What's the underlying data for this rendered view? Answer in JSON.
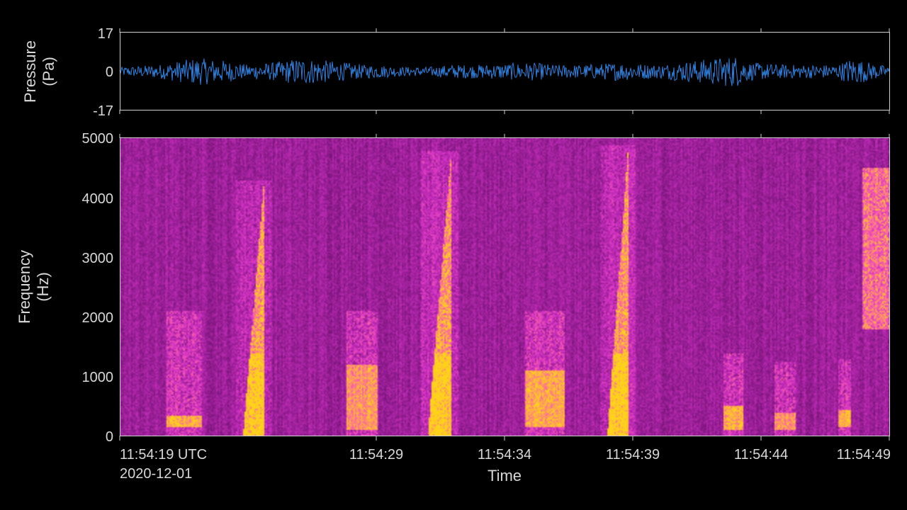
{
  "chart_data": [
    {
      "type": "line",
      "ylabel_line1": "Pressure",
      "ylabel_line2": "(Pa)",
      "ylim": [
        -17,
        17
      ],
      "yticks": [
        "17",
        "0",
        "-17"
      ],
      "color": "#2f7fdc",
      "time_range_s": [
        0,
        30
      ],
      "amplitude_envelope": [
        {
          "t": 0,
          "a": 2
        },
        {
          "t": 1.5,
          "a": 3
        },
        {
          "t": 3,
          "a": 6
        },
        {
          "t": 4,
          "a": 5
        },
        {
          "t": 5,
          "a": 3
        },
        {
          "t": 6,
          "a": 4
        },
        {
          "t": 7,
          "a": 6
        },
        {
          "t": 8,
          "a": 5
        },
        {
          "t": 9.5,
          "a": 3
        },
        {
          "t": 10,
          "a": 3
        },
        {
          "t": 11,
          "a": 2
        },
        {
          "t": 12,
          "a": 2
        },
        {
          "t": 13,
          "a": 3
        },
        {
          "t": 14,
          "a": 3
        },
        {
          "t": 16,
          "a": 4
        },
        {
          "t": 17,
          "a": 3
        },
        {
          "t": 18,
          "a": 3
        },
        {
          "t": 19.5,
          "a": 4
        },
        {
          "t": 21,
          "a": 3
        },
        {
          "t": 24,
          "a": 7
        },
        {
          "t": 24.5,
          "a": 4
        },
        {
          "t": 26,
          "a": 3
        },
        {
          "t": 28,
          "a": 3
        },
        {
          "t": 28.5,
          "a": 6
        },
        {
          "t": 30,
          "a": 2
        }
      ]
    },
    {
      "type": "heatmap",
      "title": "",
      "xlabel": "Time",
      "ylabel_line1": "Frequency",
      "ylabel_line2": "(Hz)",
      "ylim": [
        0,
        5000
      ],
      "yticks": [
        "5000",
        "4000",
        "3000",
        "2000",
        "1000",
        "0"
      ],
      "xticks": [
        {
          "t": 0,
          "label": "11:54:19 UTC"
        },
        {
          "t": 10,
          "label": "11:54:29"
        },
        {
          "t": 15,
          "label": "11:54:34"
        },
        {
          "t": 20,
          "label": "11:54:39"
        },
        {
          "t": 25,
          "label": "11:54:44"
        },
        {
          "t": 30,
          "label": "11:54:49"
        }
      ],
      "date_label": "2020-12-01",
      "colormap": [
        "#000000",
        "#3a0a3e",
        "#8a1a8a",
        "#d633c8",
        "#ff66a0",
        "#ffd21a"
      ],
      "calls": [
        {
          "t0": 1.8,
          "t1": 3.2,
          "f0": 150,
          "f1": 250,
          "type": "band",
          "hi": 1200,
          "intensity": 0.9
        },
        {
          "t0": 4.8,
          "t1": 5.6,
          "f0": 100,
          "f1": 4300,
          "type": "sweep",
          "intensity": 1.0
        },
        {
          "t0": 8.8,
          "t1": 10.0,
          "f0": 100,
          "f1": 1100,
          "type": "band",
          "hi": 1200,
          "intensity": 0.8
        },
        {
          "t0": 12.0,
          "t1": 12.9,
          "f0": 100,
          "f1": 4800,
          "type": "sweep",
          "intensity": 1.0
        },
        {
          "t0": 15.8,
          "t1": 17.3,
          "f0": 150,
          "f1": 1000,
          "type": "band",
          "hi": 1200,
          "intensity": 0.85
        },
        {
          "t0": 19.0,
          "t1": 19.8,
          "f0": 100,
          "f1": 4900,
          "type": "sweep",
          "intensity": 1.0
        },
        {
          "t0": 23.5,
          "t1": 24.3,
          "f0": 100,
          "f1": 400,
          "type": "band",
          "hi": 500,
          "intensity": 0.9
        },
        {
          "t0": 25.5,
          "t1": 26.3,
          "f0": 100,
          "f1": 300,
          "type": "band",
          "hi": 350,
          "intensity": 0.8
        },
        {
          "t0": 28.0,
          "t1": 28.5,
          "f0": 150,
          "f1": 350,
          "type": "band",
          "hi": 400,
          "intensity": 0.9
        },
        {
          "t0": 28.9,
          "t1": 30.0,
          "f0": 1800,
          "f1": 4500,
          "type": "patch",
          "intensity": 0.9
        }
      ]
    }
  ]
}
